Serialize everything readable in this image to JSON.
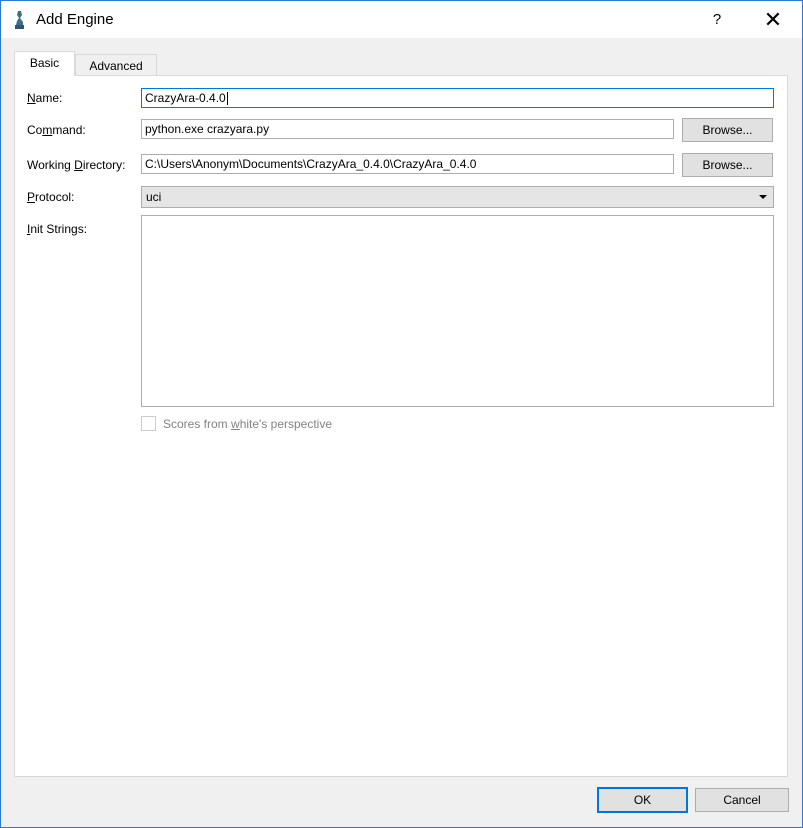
{
  "window": {
    "title": "Add Engine",
    "help": "?",
    "close": "✕"
  },
  "tabs": [
    {
      "label": "Basic"
    },
    {
      "label": "Advanced"
    }
  ],
  "form": {
    "name": {
      "label_pre": "",
      "label_ul": "N",
      "label_post": "ame:",
      "value": "CrazyAra-0.4.0"
    },
    "command": {
      "label_pre": "Co",
      "label_ul": "m",
      "label_post": "mand:",
      "value": "python.exe crazyara.py",
      "browse": "Browse..."
    },
    "working_directory": {
      "label_pre": "Working ",
      "label_ul": "D",
      "label_post": "irectory:",
      "value": "C:\\Users\\Anonym\\Documents\\CrazyAra_0.4.0\\CrazyAra_0.4.0",
      "browse": "Browse..."
    },
    "protocol": {
      "label_pre": "",
      "label_ul": "P",
      "label_post": "rotocol:",
      "value": "uci"
    },
    "init_strings": {
      "label_pre": "",
      "label_ul": "I",
      "label_post": "nit Strings:",
      "value": ""
    },
    "scores_checkbox": {
      "label_pre": "Scores from ",
      "label_ul": "w",
      "label_post": "hite's perspective",
      "checked": false,
      "enabled": false
    }
  },
  "buttons": {
    "ok": "OK",
    "cancel": "Cancel"
  }
}
